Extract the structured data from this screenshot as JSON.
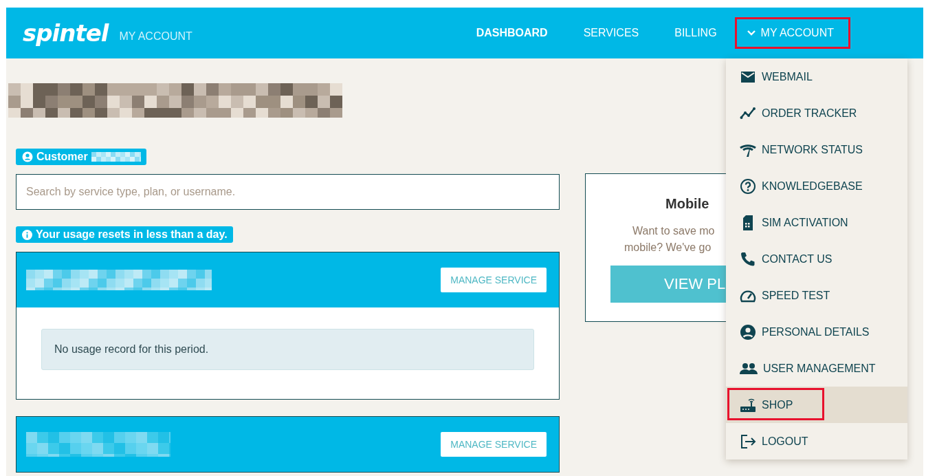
{
  "header": {
    "logo": "spintel",
    "subtitle": "MY ACCOUNT",
    "nav": [
      {
        "label": "DASHBOARD",
        "selected": true,
        "expanded": false,
        "highlighted": false
      },
      {
        "label": "SERVICES",
        "selected": false,
        "expanded": false,
        "highlighted": false
      },
      {
        "label": "BILLING",
        "selected": false,
        "expanded": false,
        "highlighted": false
      },
      {
        "label": "MY ACCOUNT",
        "selected": false,
        "expanded": true,
        "highlighted": true
      }
    ]
  },
  "customer_badge": {
    "label": "Customer"
  },
  "search": {
    "placeholder": "Search by service type, plan, or username."
  },
  "usage_notice": "Your usage resets in less than a day.",
  "services": [
    {
      "button": "MANAGE SERVICE",
      "message": "No usage record for this period."
    },
    {
      "button": "MANAGE SERVICE"
    }
  ],
  "promo": {
    "title": "Mobile",
    "lines": [
      "Want to save mo",
      "mobile? We've go"
    ],
    "button": "VIEW PL"
  },
  "account_menu": [
    {
      "label": "WEBMAIL",
      "selected": false,
      "highlighted": false
    },
    {
      "label": "ORDER TRACKER",
      "selected": false,
      "highlighted": false
    },
    {
      "label": "NETWORK STATUS",
      "selected": false,
      "highlighted": false
    },
    {
      "label": "KNOWLEDGEBASE",
      "selected": false,
      "highlighted": false
    },
    {
      "label": "SIM ACTIVATION",
      "selected": false,
      "highlighted": false
    },
    {
      "label": "CONTACT US",
      "selected": false,
      "highlighted": false
    },
    {
      "label": "SPEED TEST",
      "selected": false,
      "highlighted": false
    },
    {
      "label": "PERSONAL DETAILS",
      "selected": false,
      "highlighted": false
    },
    {
      "label": "USER MANAGEMENT",
      "selected": false,
      "highlighted": false
    },
    {
      "label": "SHOP",
      "selected": true,
      "highlighted": true
    },
    {
      "label": "LOGOUT",
      "selected": false,
      "highlighted": false
    }
  ]
}
